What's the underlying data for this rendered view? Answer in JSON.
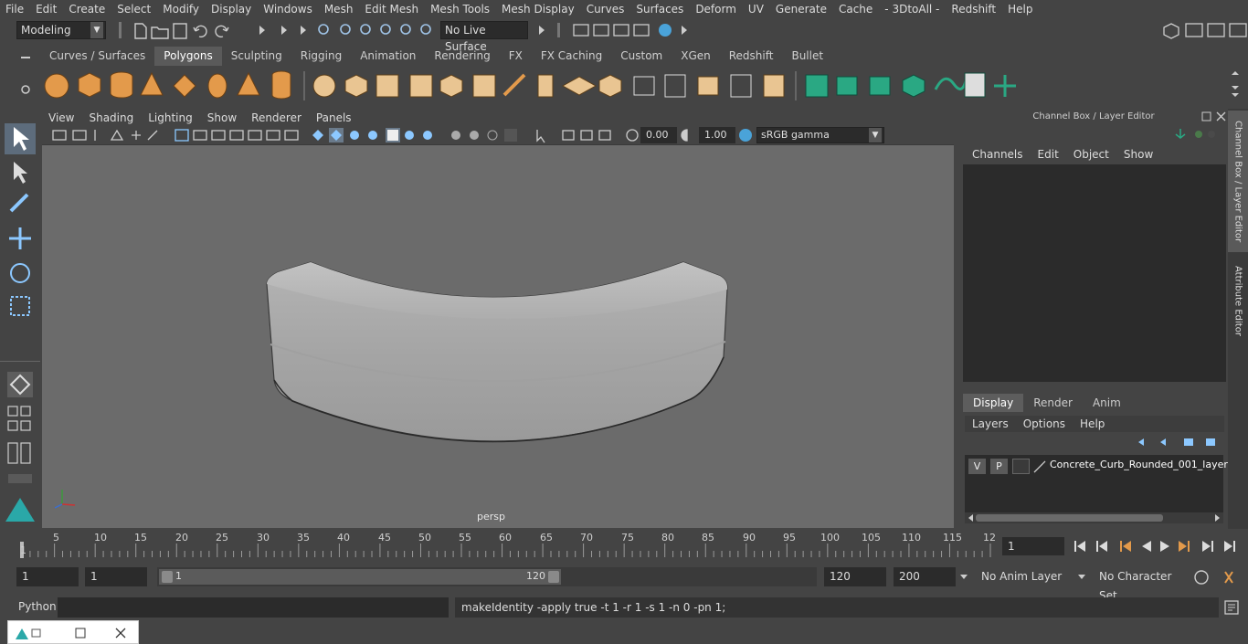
{
  "menubar": {
    "items": [
      "File",
      "Edit",
      "Create",
      "Select",
      "Modify",
      "Display",
      "Windows",
      "Mesh",
      "Edit Mesh",
      "Mesh Tools",
      "Mesh Display",
      "Curves",
      "Surfaces",
      "Deform",
      "UV",
      "Generate",
      "Cache",
      "- 3DtoAll -",
      "Redshift",
      "Help"
    ]
  },
  "statusline": {
    "mode": "Modeling",
    "live_surface": "No Live Surface"
  },
  "shelf": {
    "tabs": [
      "Curves / Surfaces",
      "Polygons",
      "Sculpting",
      "Rigging",
      "Animation",
      "Rendering",
      "FX",
      "FX Caching",
      "Custom",
      "XGen",
      "Redshift",
      "Bullet"
    ],
    "active_tab": "Polygons"
  },
  "viewport": {
    "menu": [
      "View",
      "Shading",
      "Lighting",
      "Show",
      "Renderer",
      "Panels"
    ],
    "exposure": "0.00",
    "gamma": "1.00",
    "color_space": "sRGB gamma",
    "camera_label": "persp"
  },
  "channel_box": {
    "title": "Channel Box / Layer Editor",
    "menu": [
      "Channels",
      "Edit",
      "Object",
      "Show"
    ]
  },
  "layer_editor": {
    "tabs": [
      "Display",
      "Render",
      "Anim"
    ],
    "active_tab": "Display",
    "menu": [
      "Layers",
      "Options",
      "Help"
    ],
    "layers": [
      {
        "v": "V",
        "p": "P",
        "name": "Concrete_Curb_Rounded_001_layer"
      }
    ]
  },
  "side_tabs": [
    "Channel Box / Layer Editor",
    "Attribute Editor"
  ],
  "timeline": {
    "ticks": [
      "5",
      "10",
      "15",
      "20",
      "25",
      "30",
      "35",
      "40",
      "45",
      "50",
      "55",
      "60",
      "65",
      "70",
      "75",
      "80",
      "85",
      "90",
      "95",
      "100",
      "105",
      "110",
      "115",
      "12"
    ],
    "start_label": "1",
    "current_frame": "1"
  },
  "range": {
    "start": "1",
    "playback_start": "1",
    "slider_start": "1",
    "slider_end": "120",
    "end": "120",
    "anim_end": "200",
    "anim_layer": "No Anim Layer",
    "character_set": "No Character Set"
  },
  "command_line": {
    "label": "Python",
    "output": "makeIdentity -apply true -t 1 -r 1 -s 1 -n 0 -pn 1;"
  },
  "colors": {
    "accent_orange": "#e39a4b",
    "accent_green": "#2aa883",
    "accent_blue": "#4aa3d9",
    "panel_bg": "#444444",
    "viewport_bg": "#6b6b6b"
  }
}
